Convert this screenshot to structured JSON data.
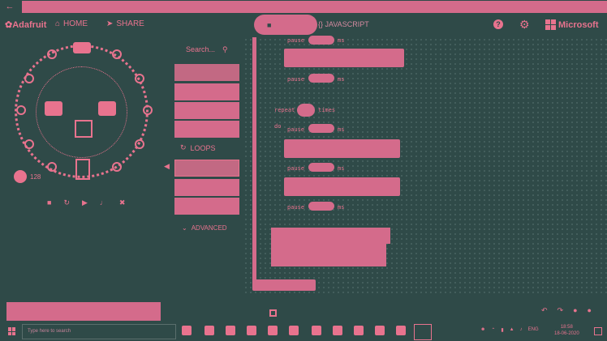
{
  "app": {
    "logo": "Adafruit",
    "brand": "Microsoft"
  },
  "header": {
    "home_label": "HOME",
    "share_label": "SHARE",
    "blocks_tab_label": "",
    "js_tab_label": "JAVASCRIPT",
    "help_symbol": "?"
  },
  "simulator": {
    "light_value": "128"
  },
  "toolbox": {
    "search_placeholder": "Search...",
    "loops_label": "LOOPS",
    "advanced_label": "ADVANCED"
  },
  "workspace": {
    "blocks": [
      {
        "keyword": "pause",
        "unit": "ms"
      },
      {
        "keyword": "pause",
        "unit": "ms"
      },
      {
        "keyword": "repeat",
        "suffix": "times"
      },
      {
        "keyword": "do"
      },
      {
        "keyword": "pause",
        "unit": "ms"
      },
      {
        "keyword": "pause",
        "unit": "ms"
      },
      {
        "keyword": "pause",
        "unit": "ms"
      }
    ]
  },
  "taskbar": {
    "search_placeholder": "Type here to search",
    "language": "ENG",
    "time": "18:58",
    "date": "18-06-2020"
  },
  "colors": {
    "background": "#2f4a48",
    "accent": "#d46b8b"
  }
}
